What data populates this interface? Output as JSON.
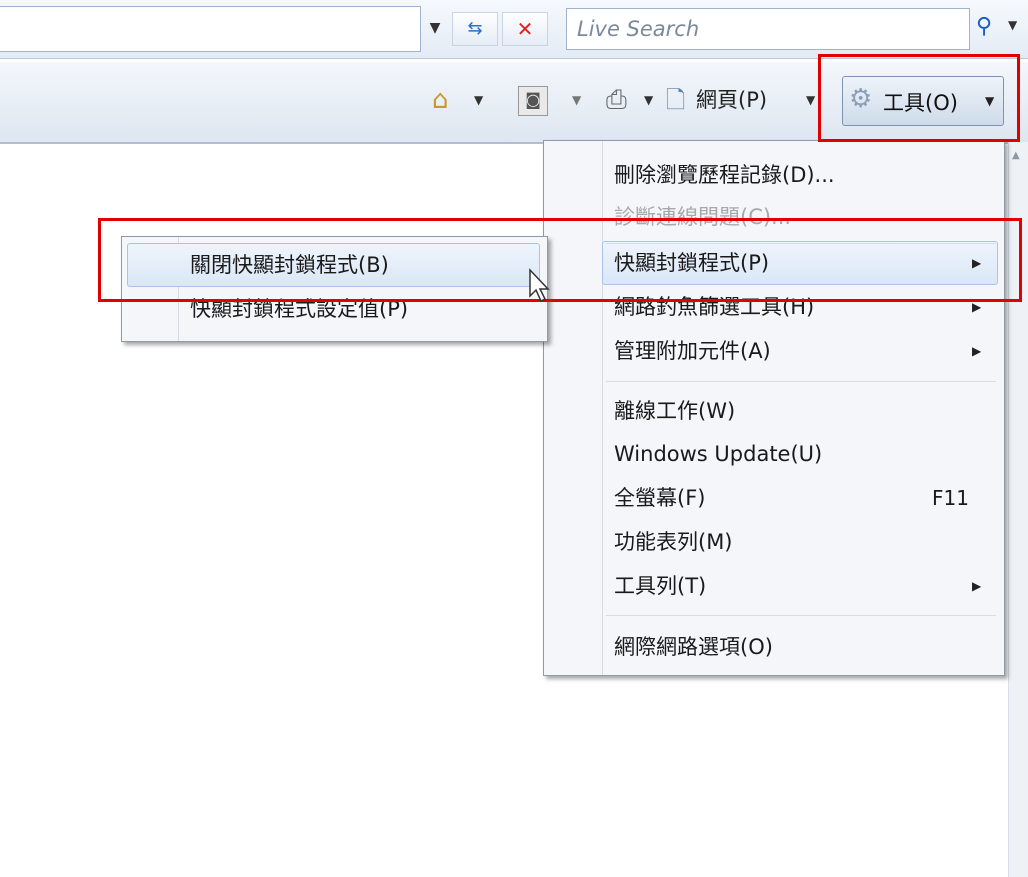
{
  "search": {
    "placeholder": "Live Search"
  },
  "command_bar": {
    "page_label": "網頁(P)",
    "tools_label": "工具(O)"
  },
  "tools_menu": {
    "items": [
      {
        "label": "刪除瀏覽歷程記錄(D)...",
        "disabled": false
      },
      {
        "label": "診斷連線問題(C)...",
        "disabled": true
      },
      {
        "label": "快顯封鎖程式(P)",
        "submenu": true,
        "highlighted": true
      },
      {
        "label": "網路釣魚篩選工具(H)",
        "submenu": true
      },
      {
        "label": "管理附加元件(A)",
        "submenu": true
      },
      {
        "label": "離線工作(W)"
      },
      {
        "label": "Windows Update(U)"
      },
      {
        "label": "全螢幕(F)",
        "shortcut": "F11"
      },
      {
        "label": "功能表列(M)"
      },
      {
        "label": "工具列(T)",
        "submenu": true
      },
      {
        "label": "網際網路選項(O)"
      }
    ]
  },
  "popup_submenu": {
    "items": [
      {
        "label": "關閉快顯封鎖程式(B)",
        "highlighted": true
      },
      {
        "label": "快顯封鎖程式設定值(P)"
      }
    ]
  },
  "colors": {
    "highlight_frame": "#e00000",
    "menu_bg": "#f4f6f9"
  }
}
